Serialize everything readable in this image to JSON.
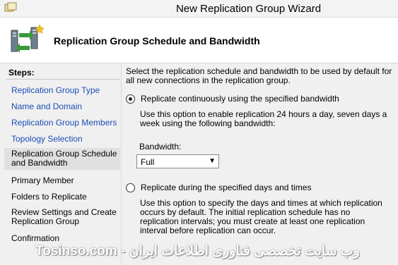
{
  "window": {
    "title": "New Replication Group Wizard"
  },
  "header": {
    "heading": "Replication Group Schedule and Bandwidth"
  },
  "steps": {
    "title": "Steps:",
    "items": [
      {
        "label": "Replication Group Type",
        "state": "link"
      },
      {
        "label": "Name and Domain",
        "state": "link"
      },
      {
        "label": "Replication Group Members",
        "state": "link"
      },
      {
        "label": "Topology Selection",
        "state": "link"
      },
      {
        "label": "Replication Group Schedule and Bandwidth",
        "state": "current"
      },
      {
        "label": "Primary Member",
        "state": "plain"
      },
      {
        "label": "Folders to Replicate",
        "state": "plain"
      },
      {
        "label": "Review Settings and Create Replication Group",
        "state": "plain"
      },
      {
        "label": "Confirmation",
        "state": "plain"
      }
    ]
  },
  "content": {
    "description": "Select the replication schedule and bandwidth to be used by default for all new connections in the replication group.",
    "option_continuous": {
      "label": "Replicate continuously using the specified bandwidth",
      "selected": true,
      "help": "Use this option to enable replication 24 hours a day, seven days a week using the following bandwidth:",
      "bandwidth_label": "Bandwidth:",
      "bandwidth_value": "Full"
    },
    "option_scheduled": {
      "label": "Replicate during the specified days and times",
      "selected": false,
      "help": "Use this option to specify the days and times at which replication occurs by default. The initial replication schedule has no replication intervals; you must create at least one replication interval before replication can occur."
    }
  },
  "watermark": {
    "text": "Tosinso.com - وب سایت تخصصی فناوری اطلاعات ایران"
  },
  "colors": {
    "link": "#1a4fb5",
    "panel": "#f0f0f0",
    "current_step": "#e0e0e0"
  }
}
